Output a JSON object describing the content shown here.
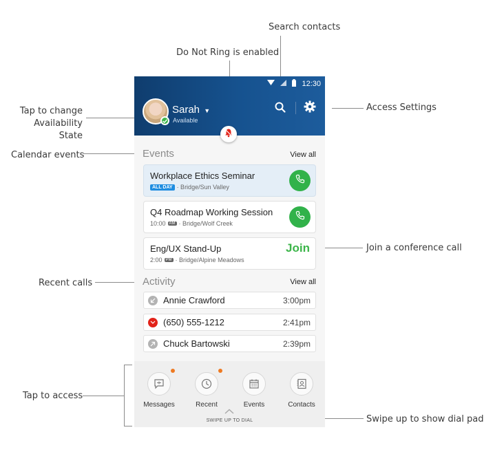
{
  "annotations": {
    "search_contacts": "Search contacts",
    "do_not_ring": "Do Not Ring is enabled",
    "tap_change_line1": "Tap to change",
    "tap_change_line2": "Availability State",
    "access_settings": "Access Settings",
    "calendar_events": "Calendar  events",
    "join_conference": "Join a conference call",
    "recent_calls": "Recent  calls",
    "tap_to_access": "Tap to access",
    "swipe_up": "Swipe up to show dial pad"
  },
  "statusbar": {
    "time": "12:30"
  },
  "header": {
    "user_name": "Sarah",
    "user_status": "Available"
  },
  "events": {
    "title": "Events",
    "view_all": "View all",
    "items": [
      {
        "title": "Workplace Ethics Seminar",
        "badge": "ALL DAY",
        "location": "· Bridge/Sun Valley"
      },
      {
        "title": "Q4 Roadmap Working Session",
        "time": "10:00",
        "tag": "AM",
        "location": "· Bridge/Wolf Creek"
      },
      {
        "title": "Eng/UX Stand-Up",
        "time": "2:00",
        "tag": "PM",
        "location": "· Bridge/Alpine Meadows",
        "join": "Join"
      }
    ]
  },
  "activity": {
    "title": "Activity",
    "view_all": "View all",
    "items": [
      {
        "name": "Annie Crawford",
        "time": "3:00pm"
      },
      {
        "name": "(650) 555-1212",
        "time": "2:41pm"
      },
      {
        "name": "Chuck Bartowski",
        "time": "2:39pm"
      }
    ]
  },
  "nav": {
    "messages": "Messages",
    "recent": "Recent",
    "events": "Events",
    "contacts": "Contacts",
    "swipe_hint": "SWIPE UP TO DIAL"
  },
  "colors": {
    "header": "#16528f",
    "green": "#31b24a",
    "missed": "#e2231a",
    "notify": "#ee7a22",
    "badge": "#1f8de0"
  }
}
